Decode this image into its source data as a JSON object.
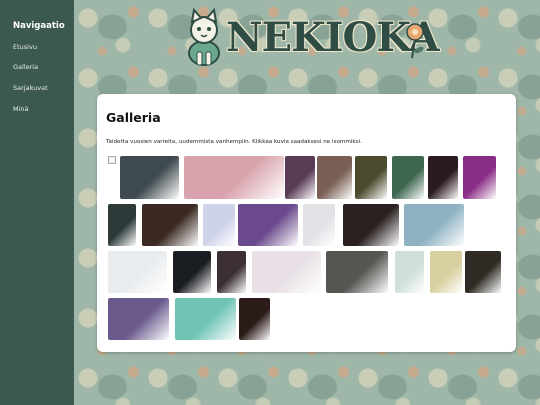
{
  "sidebar": {
    "title": "Navigaatio",
    "items": [
      {
        "label": "Etusivu"
      },
      {
        "label": "Galleria"
      },
      {
        "label": "Sarjakuvat"
      },
      {
        "label": "Minä"
      }
    ]
  },
  "header": {
    "logo_text": "NEKIOKA"
  },
  "main": {
    "title": "Galleria",
    "intro": "Taidetta vuosien varrelta, uudemmista vanhempiin. Klikkaa kuvia saadaksesi ne isommiksi."
  },
  "colors": {
    "sidebar_bg": "#3c5950",
    "logo_green": "#2f4d44",
    "background_pattern": "#9fb7a9",
    "card_bg": "#ffffff"
  },
  "gallery": [
    {
      "icon": "broken-image-icon"
    },
    {
      "color": "#3e4a4f"
    },
    {
      "color": "#d9a3ad"
    },
    {
      "color": "#5a3b56"
    },
    {
      "color": "#7a5f55"
    },
    {
      "color": "#4b4a2c"
    },
    {
      "color": "#3e6650"
    },
    {
      "color": "#2c1a22"
    },
    {
      "color": "#8a2d87"
    },
    {
      "color": "#2d3a3a"
    },
    {
      "color": "#3a2a22"
    },
    {
      "color": "#cfd3ea"
    },
    {
      "color": "#6a4a8c"
    },
    {
      "color": "#e3e1e6"
    },
    {
      "color": "#2a2020"
    },
    {
      "color": "#8fb2c2"
    },
    {
      "color": "#e9ecef"
    },
    {
      "color": "#1a1d22"
    },
    {
      "color": "#3c3035"
    },
    {
      "color": "#e8e0e6"
    },
    {
      "color": "#575552"
    },
    {
      "color": "#cfe0d8"
    },
    {
      "color": "#d8d0a0"
    },
    {
      "color": "#2f2a24"
    },
    {
      "color": "#6a5a8c"
    },
    {
      "color": "#6fc4b6"
    },
    {
      "color": "#2a1a18"
    }
  ]
}
